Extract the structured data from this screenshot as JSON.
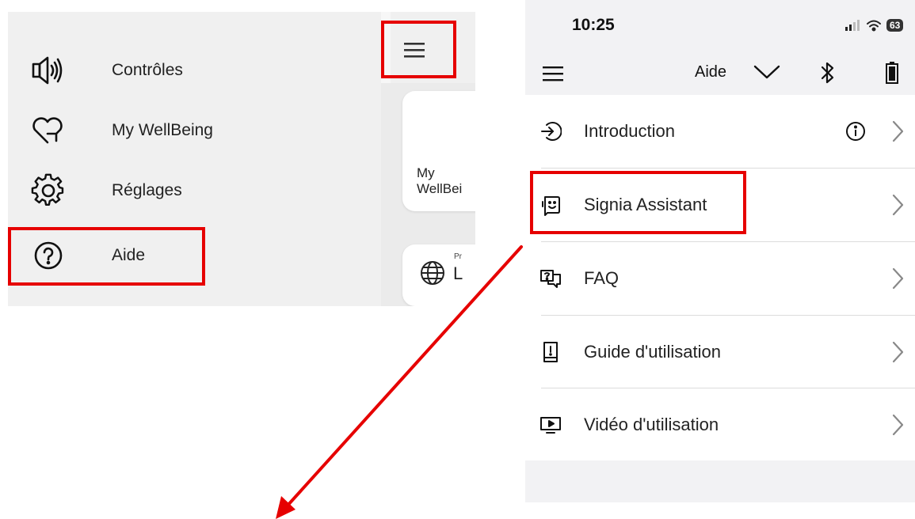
{
  "left_menu": {
    "items": [
      {
        "label": "Contrôles",
        "icon": "speaker-icon"
      },
      {
        "label": "My WellBeing",
        "icon": "heart-arrow-icon"
      },
      {
        "label": "Réglages",
        "icon": "gear-icon"
      },
      {
        "label": "Aide",
        "icon": "help-circle-icon"
      }
    ],
    "card_text": "My\nWellBei",
    "card2_small": "Pr",
    "card2_big": "L"
  },
  "phone": {
    "status": {
      "time": "10:25",
      "battery": "63"
    },
    "topbar": {
      "title": "Aide"
    },
    "help_list": [
      {
        "label": "Introduction",
        "icon": "login-arrow-icon",
        "info": true
      },
      {
        "label": "Signia Assistant",
        "icon": "assistant-face-icon",
        "info": false
      },
      {
        "label": "FAQ",
        "icon": "faq-chat-icon",
        "info": false
      },
      {
        "label": "Guide d'utilisation",
        "icon": "manual-book-icon",
        "info": false
      },
      {
        "label": "Vidéo d'utilisation",
        "icon": "video-screen-icon",
        "info": false
      }
    ]
  },
  "colors": {
    "highlight": "#e60000",
    "panel_bg": "#f0f0f0",
    "phone_bg": "#f2f2f4"
  }
}
